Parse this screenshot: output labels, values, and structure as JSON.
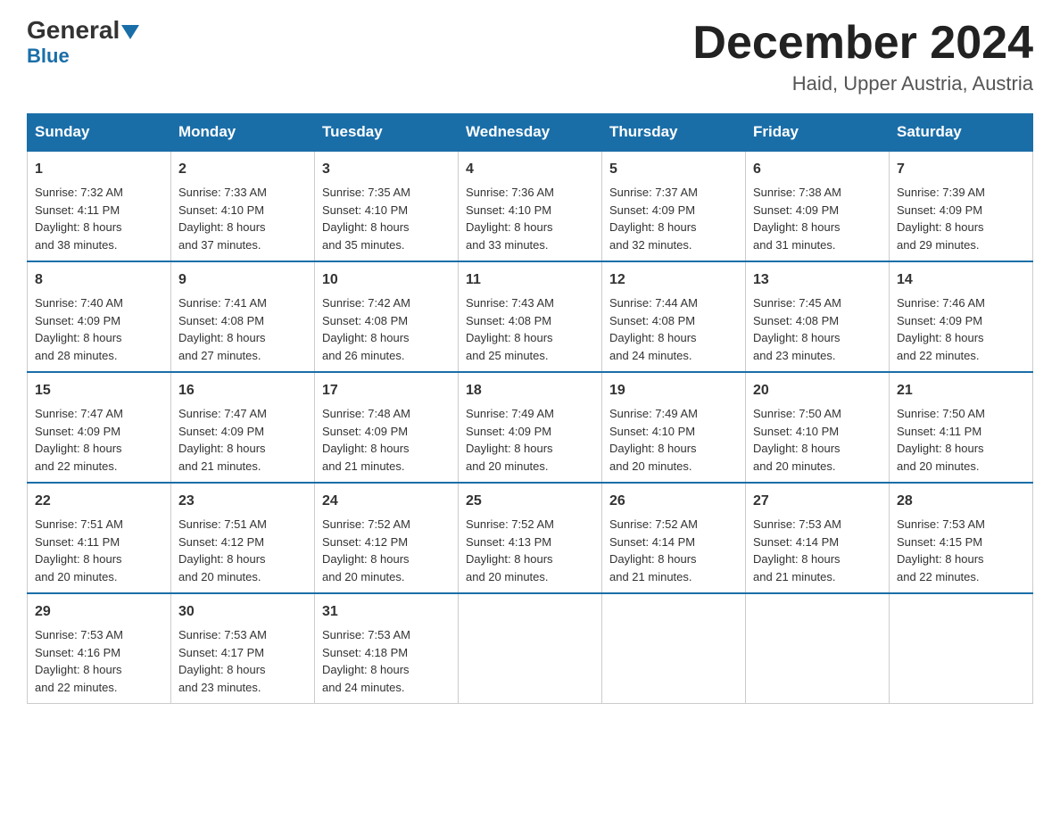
{
  "logo": {
    "name": "General",
    "blue": "Blue"
  },
  "title": "December 2024",
  "location": "Haid, Upper Austria, Austria",
  "days_of_week": [
    "Sunday",
    "Monday",
    "Tuesday",
    "Wednesday",
    "Thursday",
    "Friday",
    "Saturday"
  ],
  "weeks": [
    [
      {
        "day": "1",
        "info": "Sunrise: 7:32 AM\nSunset: 4:11 PM\nDaylight: 8 hours\nand 38 minutes."
      },
      {
        "day": "2",
        "info": "Sunrise: 7:33 AM\nSunset: 4:10 PM\nDaylight: 8 hours\nand 37 minutes."
      },
      {
        "day": "3",
        "info": "Sunrise: 7:35 AM\nSunset: 4:10 PM\nDaylight: 8 hours\nand 35 minutes."
      },
      {
        "day": "4",
        "info": "Sunrise: 7:36 AM\nSunset: 4:10 PM\nDaylight: 8 hours\nand 33 minutes."
      },
      {
        "day": "5",
        "info": "Sunrise: 7:37 AM\nSunset: 4:09 PM\nDaylight: 8 hours\nand 32 minutes."
      },
      {
        "day": "6",
        "info": "Sunrise: 7:38 AM\nSunset: 4:09 PM\nDaylight: 8 hours\nand 31 minutes."
      },
      {
        "day": "7",
        "info": "Sunrise: 7:39 AM\nSunset: 4:09 PM\nDaylight: 8 hours\nand 29 minutes."
      }
    ],
    [
      {
        "day": "8",
        "info": "Sunrise: 7:40 AM\nSunset: 4:09 PM\nDaylight: 8 hours\nand 28 minutes."
      },
      {
        "day": "9",
        "info": "Sunrise: 7:41 AM\nSunset: 4:08 PM\nDaylight: 8 hours\nand 27 minutes."
      },
      {
        "day": "10",
        "info": "Sunrise: 7:42 AM\nSunset: 4:08 PM\nDaylight: 8 hours\nand 26 minutes."
      },
      {
        "day": "11",
        "info": "Sunrise: 7:43 AM\nSunset: 4:08 PM\nDaylight: 8 hours\nand 25 minutes."
      },
      {
        "day": "12",
        "info": "Sunrise: 7:44 AM\nSunset: 4:08 PM\nDaylight: 8 hours\nand 24 minutes."
      },
      {
        "day": "13",
        "info": "Sunrise: 7:45 AM\nSunset: 4:08 PM\nDaylight: 8 hours\nand 23 minutes."
      },
      {
        "day": "14",
        "info": "Sunrise: 7:46 AM\nSunset: 4:09 PM\nDaylight: 8 hours\nand 22 minutes."
      }
    ],
    [
      {
        "day": "15",
        "info": "Sunrise: 7:47 AM\nSunset: 4:09 PM\nDaylight: 8 hours\nand 22 minutes."
      },
      {
        "day": "16",
        "info": "Sunrise: 7:47 AM\nSunset: 4:09 PM\nDaylight: 8 hours\nand 21 minutes."
      },
      {
        "day": "17",
        "info": "Sunrise: 7:48 AM\nSunset: 4:09 PM\nDaylight: 8 hours\nand 21 minutes."
      },
      {
        "day": "18",
        "info": "Sunrise: 7:49 AM\nSunset: 4:09 PM\nDaylight: 8 hours\nand 20 minutes."
      },
      {
        "day": "19",
        "info": "Sunrise: 7:49 AM\nSunset: 4:10 PM\nDaylight: 8 hours\nand 20 minutes."
      },
      {
        "day": "20",
        "info": "Sunrise: 7:50 AM\nSunset: 4:10 PM\nDaylight: 8 hours\nand 20 minutes."
      },
      {
        "day": "21",
        "info": "Sunrise: 7:50 AM\nSunset: 4:11 PM\nDaylight: 8 hours\nand 20 minutes."
      }
    ],
    [
      {
        "day": "22",
        "info": "Sunrise: 7:51 AM\nSunset: 4:11 PM\nDaylight: 8 hours\nand 20 minutes."
      },
      {
        "day": "23",
        "info": "Sunrise: 7:51 AM\nSunset: 4:12 PM\nDaylight: 8 hours\nand 20 minutes."
      },
      {
        "day": "24",
        "info": "Sunrise: 7:52 AM\nSunset: 4:12 PM\nDaylight: 8 hours\nand 20 minutes."
      },
      {
        "day": "25",
        "info": "Sunrise: 7:52 AM\nSunset: 4:13 PM\nDaylight: 8 hours\nand 20 minutes."
      },
      {
        "day": "26",
        "info": "Sunrise: 7:52 AM\nSunset: 4:14 PM\nDaylight: 8 hours\nand 21 minutes."
      },
      {
        "day": "27",
        "info": "Sunrise: 7:53 AM\nSunset: 4:14 PM\nDaylight: 8 hours\nand 21 minutes."
      },
      {
        "day": "28",
        "info": "Sunrise: 7:53 AM\nSunset: 4:15 PM\nDaylight: 8 hours\nand 22 minutes."
      }
    ],
    [
      {
        "day": "29",
        "info": "Sunrise: 7:53 AM\nSunset: 4:16 PM\nDaylight: 8 hours\nand 22 minutes."
      },
      {
        "day": "30",
        "info": "Sunrise: 7:53 AM\nSunset: 4:17 PM\nDaylight: 8 hours\nand 23 minutes."
      },
      {
        "day": "31",
        "info": "Sunrise: 7:53 AM\nSunset: 4:18 PM\nDaylight: 8 hours\nand 24 minutes."
      },
      {
        "day": "",
        "info": ""
      },
      {
        "day": "",
        "info": ""
      },
      {
        "day": "",
        "info": ""
      },
      {
        "day": "",
        "info": ""
      }
    ]
  ]
}
